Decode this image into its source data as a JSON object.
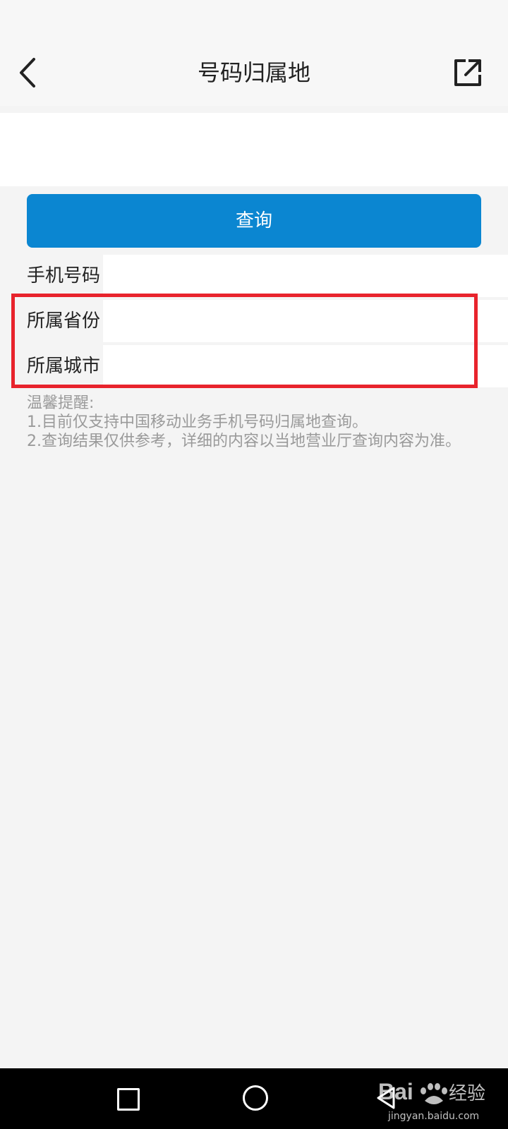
{
  "header": {
    "title": "号码归属地",
    "back_icon": "chevron-left-icon",
    "share_icon": "share-external-icon"
  },
  "search": {
    "value": "",
    "placeholder": ""
  },
  "query_button": {
    "label": "查询",
    "color": "#0b86d1"
  },
  "results": {
    "phone_label": "手机号码",
    "phone_value": "",
    "province_label": "所属省份",
    "province_value": "",
    "city_label": "所属城市",
    "city_value": ""
  },
  "highlight_color": "#e8232c",
  "tips": {
    "title": "温馨提醒:",
    "line1": "1.目前仅支持中国移动业务手机号码归属地查询。",
    "line2": "2.查询结果仅供参考，详细的内容以当地营业厅查询内容为准。"
  },
  "navbar": {
    "recent_icon": "square-icon",
    "home_icon": "circle-icon",
    "back_icon": "triangle-back-icon"
  },
  "watermark": {
    "brand": "Bai",
    "brand_suffix": "经验",
    "domain": "jingyan.baidu.com"
  }
}
